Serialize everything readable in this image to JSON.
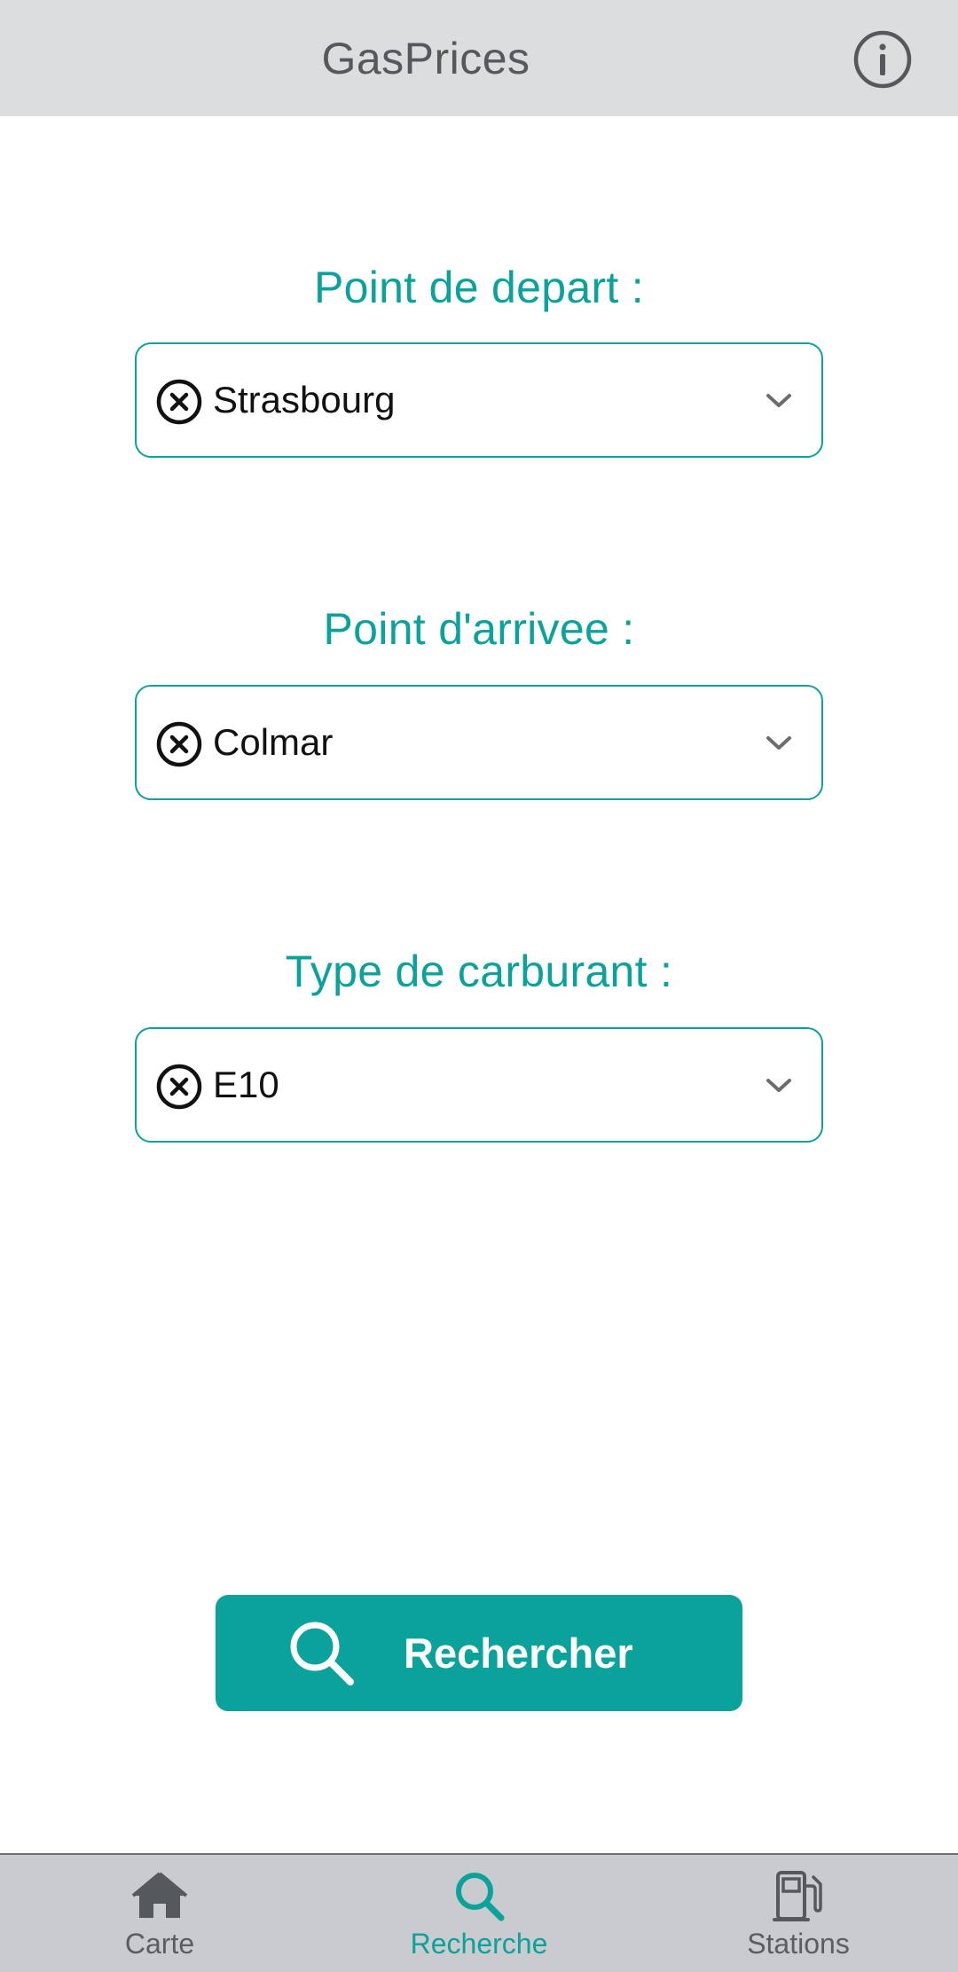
{
  "header": {
    "title": "GasPrices",
    "info_icon": "info-circle-icon"
  },
  "fields": [
    {
      "label": "Point de depart :",
      "value": "Strasbourg"
    },
    {
      "label": "Point d'arrivee :",
      "value": "Colmar"
    },
    {
      "label": "Type de carburant :",
      "value": "E10"
    }
  ],
  "search_button": {
    "label": "Rechercher",
    "icon": "search-icon"
  },
  "bottom_nav": {
    "items": [
      {
        "label": "Carte",
        "icon": "home-icon",
        "active": false
      },
      {
        "label": "Recherche",
        "icon": "search-icon",
        "active": true
      },
      {
        "label": "Stations",
        "icon": "gas-pump-icon",
        "active": false
      }
    ]
  },
  "colors": {
    "accent": "#0ca29c",
    "header_bg": "#dcdddf",
    "nav_bg": "#c9cbce",
    "text_muted": "#5a5e62"
  }
}
